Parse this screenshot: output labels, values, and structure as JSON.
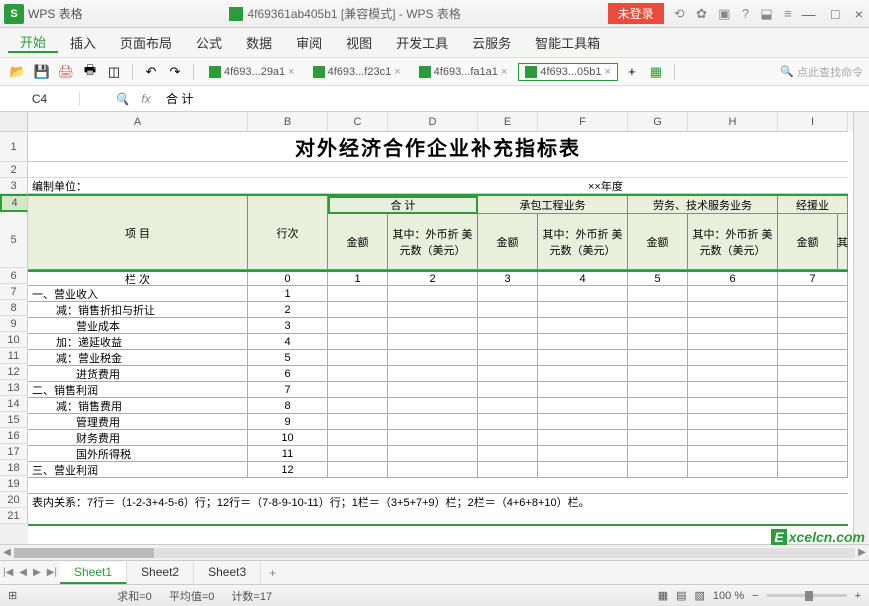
{
  "app": {
    "badge": "S",
    "name": "WPS 表格",
    "doc_title": "4f69361ab405b1 [兼容模式] - WPS 表格",
    "login": "未登录"
  },
  "menu": {
    "items": [
      "开始",
      "插入",
      "页面布局",
      "公式",
      "数据",
      "审阅",
      "视图",
      "开发工具",
      "云服务",
      "智能工具箱"
    ],
    "active": 0
  },
  "doc_tabs": {
    "items": [
      "4f693...29a1",
      "4f693...f23c1",
      "4f693...fa1a1",
      "4f693...05b1"
    ],
    "active": 3
  },
  "search_hint": "点此查找命令",
  "formula_bar": {
    "cell_ref": "C4",
    "value": "合  计"
  },
  "columns": [
    "A",
    "B",
    "C",
    "D",
    "E",
    "F",
    "G",
    "H",
    "I"
  ],
  "rows": [
    "1",
    "2",
    "3",
    "4",
    "5",
    "6",
    "7",
    "8",
    "9",
    "10",
    "11",
    "12",
    "13",
    "14",
    "15",
    "16",
    "17",
    "18",
    "19",
    "20",
    "21"
  ],
  "sheet": {
    "title": "对外经济合作企业补充指标表",
    "meta_label": "编制单位：",
    "meta_year": "××年度",
    "hdr_item": "项          目",
    "hdr_rownum": "行次",
    "hdr_total": "合  计",
    "hdr_contract": "承包工程业务",
    "hdr_labor": "劳务、技术服务业务",
    "hdr_aid": "经援业",
    "hdr_amount": "金额",
    "hdr_usd": "其中：外币折\n美元数（美元）",
    "hdr_usd2": "其",
    "row6_label": "栏    次",
    "row6_b": "0",
    "row6_c": "1",
    "row6_d": "2",
    "row6_e": "3",
    "row6_f": "4",
    "row6_g": "5",
    "row6_h": "6",
    "row6_i": "7",
    "data_rows": [
      {
        "a": "一、营业收入",
        "b": "1",
        "indent": 0
      },
      {
        "a": "减：销售折扣与折让",
        "b": "2",
        "indent": 1
      },
      {
        "a": "营业成本",
        "b": "3",
        "indent": 2
      },
      {
        "a": "加：递延收益",
        "b": "4",
        "indent": 1
      },
      {
        "a": "减：营业税金",
        "b": "5",
        "indent": 1
      },
      {
        "a": "进货费用",
        "b": "6",
        "indent": 2
      },
      {
        "a": "二、销售利润",
        "b": "7",
        "indent": 0
      },
      {
        "a": "减：销售费用",
        "b": "8",
        "indent": 1
      },
      {
        "a": "管理费用",
        "b": "9",
        "indent": 2
      },
      {
        "a": "财务费用",
        "b": "10",
        "indent": 2
      },
      {
        "a": "国外所得税",
        "b": "11",
        "indent": 2
      },
      {
        "a": "三、营业利润",
        "b": "12",
        "indent": 0
      }
    ],
    "note": "表内关系：7行＝（1-2-3+4-5-6）行；12行＝（7-8-9-10-11）行；1栏＝（3+5+7+9）栏；2栏＝（4+6+8+10）栏。"
  },
  "sheet_tabs": {
    "items": [
      "Sheet1",
      "Sheet2",
      "Sheet3"
    ],
    "active": 0
  },
  "statusbar": {
    "sum": "求和=0",
    "avg": "平均值=0",
    "count": "计数=17",
    "zoom": "100 %"
  },
  "watermark": {
    "e": "E",
    "text": "xcelcn.com"
  }
}
